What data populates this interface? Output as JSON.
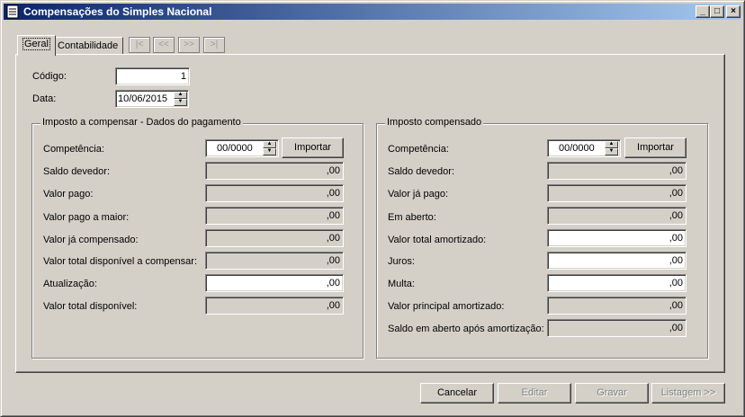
{
  "window": {
    "title": "Compensações do Simples Nacional",
    "controls": {
      "minimize": "_",
      "maximize": "□",
      "close": "×"
    }
  },
  "tabs": [
    {
      "label": "Geral"
    },
    {
      "label": "Contabilidade"
    }
  ],
  "nav": {
    "first": "|<",
    "prev": "<<",
    "next": ">>",
    "last": ">|"
  },
  "header": {
    "codigo_label": "Código:",
    "codigo_value": "1",
    "data_label": "Data:",
    "data_value": "10/06/2015"
  },
  "left_group": {
    "title": "Imposto a compensar - Dados do pagamento",
    "competencia_label": "Competência:",
    "competencia_value": "00/0000",
    "import_button": "Importar",
    "rows": [
      {
        "label": "Saldo devedor:",
        "value": ",00"
      },
      {
        "label": "Valor pago:",
        "value": ",00"
      },
      {
        "label": "Valor pago a maior:",
        "value": ",00"
      },
      {
        "label": "Valor já compensado:",
        "value": ",00"
      },
      {
        "label": "Valor total disponível a compensar:",
        "value": ",00"
      },
      {
        "label": "Atualização:",
        "value": ",00"
      },
      {
        "label": "Valor total disponível:",
        "value": ",00"
      }
    ]
  },
  "right_group": {
    "title": "Imposto compensado",
    "competencia_label": "Competência:",
    "competencia_value": "00/0000",
    "import_button": "Importar",
    "rows": [
      {
        "label": "Saldo devedor:",
        "value": ",00"
      },
      {
        "label": "Valor já pago:",
        "value": ",00"
      },
      {
        "label": "Em aberto:",
        "value": ",00"
      },
      {
        "label": "Valor total amortizado:",
        "value": ",00"
      },
      {
        "label": "Juros:",
        "value": ",00"
      },
      {
        "label": "Multa:",
        "value": ",00"
      },
      {
        "label": "Valor principal amortizado:",
        "value": ",00"
      },
      {
        "label": "Saldo em aberto após amortização:",
        "value": ",00"
      }
    ]
  },
  "footer": {
    "cancel": "Cancelar",
    "edit": "Editar",
    "save": "Gravar",
    "list": "Listagem >>"
  }
}
